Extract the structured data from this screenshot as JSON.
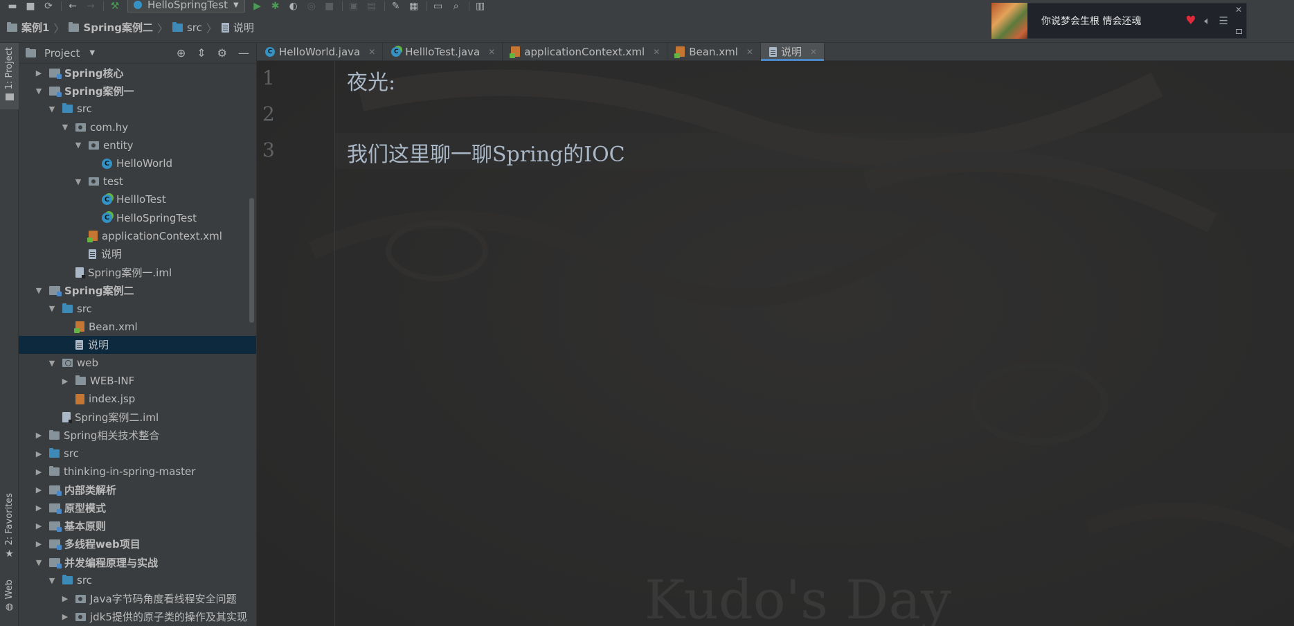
{
  "toolbar": {
    "run_config": "HelloSpringTest"
  },
  "breadcrumb": [
    "案例1",
    "Spring案例二",
    "src",
    "说明"
  ],
  "left_stripe": {
    "project": "1: Project",
    "favorites": "2: Favorites",
    "web": "Web"
  },
  "project_panel": {
    "title": "Project",
    "tree": [
      {
        "label": "Spring核心",
        "depth": 0,
        "arrow": "closed",
        "icon": "module",
        "bold": true
      },
      {
        "label": "Spring案例一",
        "depth": 0,
        "arrow": "open",
        "icon": "module",
        "bold": true
      },
      {
        "label": "src",
        "depth": 1,
        "arrow": "open",
        "icon": "src-folder"
      },
      {
        "label": "com.hy",
        "depth": 2,
        "arrow": "open",
        "icon": "package"
      },
      {
        "label": "entity",
        "depth": 3,
        "arrow": "open",
        "icon": "package"
      },
      {
        "label": "HelloWorld",
        "depth": 4,
        "arrow": "none",
        "icon": "class"
      },
      {
        "label": "test",
        "depth": 3,
        "arrow": "open",
        "icon": "package"
      },
      {
        "label": "HellloTest",
        "depth": 4,
        "arrow": "none",
        "icon": "test-class"
      },
      {
        "label": "HelloSpringTest",
        "depth": 4,
        "arrow": "none",
        "icon": "test-class"
      },
      {
        "label": "applicationContext.xml",
        "depth": 3,
        "arrow": "none",
        "icon": "xml"
      },
      {
        "label": "说明",
        "depth": 3,
        "arrow": "none",
        "icon": "text"
      },
      {
        "label": "Spring案例一.iml",
        "depth": 2,
        "arrow": "none",
        "icon": "iml"
      },
      {
        "label": "Spring案例二",
        "depth": 0,
        "arrow": "open",
        "icon": "module",
        "bold": true
      },
      {
        "label": "src",
        "depth": 1,
        "arrow": "open",
        "icon": "src-folder"
      },
      {
        "label": "Bean.xml",
        "depth": 2,
        "arrow": "none",
        "icon": "xml"
      },
      {
        "label": "说明",
        "depth": 2,
        "arrow": "none",
        "icon": "text",
        "selected": true
      },
      {
        "label": "web",
        "depth": 1,
        "arrow": "open",
        "icon": "web-folder"
      },
      {
        "label": "WEB-INF",
        "depth": 2,
        "arrow": "closed",
        "icon": "folder"
      },
      {
        "label": "index.jsp",
        "depth": 2,
        "arrow": "none",
        "icon": "jsp"
      },
      {
        "label": "Spring案例二.iml",
        "depth": 1,
        "arrow": "none",
        "icon": "iml"
      },
      {
        "label": "Spring相关技术整合",
        "depth": 0,
        "arrow": "closed",
        "icon": "folder"
      },
      {
        "label": "src",
        "depth": 0,
        "arrow": "closed",
        "icon": "src-folder"
      },
      {
        "label": "thinking-in-spring-master",
        "depth": 0,
        "arrow": "closed",
        "icon": "folder"
      },
      {
        "label": "内部类解析",
        "depth": 0,
        "arrow": "closed",
        "icon": "module",
        "bold": true
      },
      {
        "label": "原型模式",
        "depth": 0,
        "arrow": "closed",
        "icon": "module",
        "bold": true
      },
      {
        "label": "基本原则",
        "depth": 0,
        "arrow": "closed",
        "icon": "module",
        "bold": true
      },
      {
        "label": "多线程web项目",
        "depth": 0,
        "arrow": "closed",
        "icon": "module",
        "bold": true
      },
      {
        "label": "并发编程原理与实战",
        "depth": 0,
        "arrow": "open",
        "icon": "module",
        "bold": true
      },
      {
        "label": "src",
        "depth": 1,
        "arrow": "open",
        "icon": "src-folder"
      },
      {
        "label": "Java字节码角度看线程安全问题",
        "depth": 2,
        "arrow": "closed",
        "icon": "package"
      },
      {
        "label": "jdk5提供的原子类的操作及其实现",
        "depth": 2,
        "arrow": "closed",
        "icon": "package"
      }
    ]
  },
  "editor": {
    "tabs": [
      {
        "label": "HelloWorld.java",
        "icon": "class",
        "active": false
      },
      {
        "label": "HellloTest.java",
        "icon": "test-class",
        "active": false
      },
      {
        "label": "applicationContext.xml",
        "icon": "xml",
        "active": false
      },
      {
        "label": "Bean.xml",
        "icon": "xml",
        "active": false
      },
      {
        "label": "说明",
        "icon": "text",
        "active": true
      }
    ],
    "line_numbers": [
      "1",
      "2",
      "3"
    ],
    "lines": [
      "夜光:",
      "",
      "我们这里聊一聊Spring的IOC"
    ],
    "watermark": "Kudo's Day"
  },
  "music_widget": {
    "song": "你说梦会生根 情会还魂",
    "heart_color": "#e02a3c"
  },
  "colors": {
    "accent": "#4a88c7",
    "selection": "#0d293e",
    "run_green": "#499c54"
  }
}
